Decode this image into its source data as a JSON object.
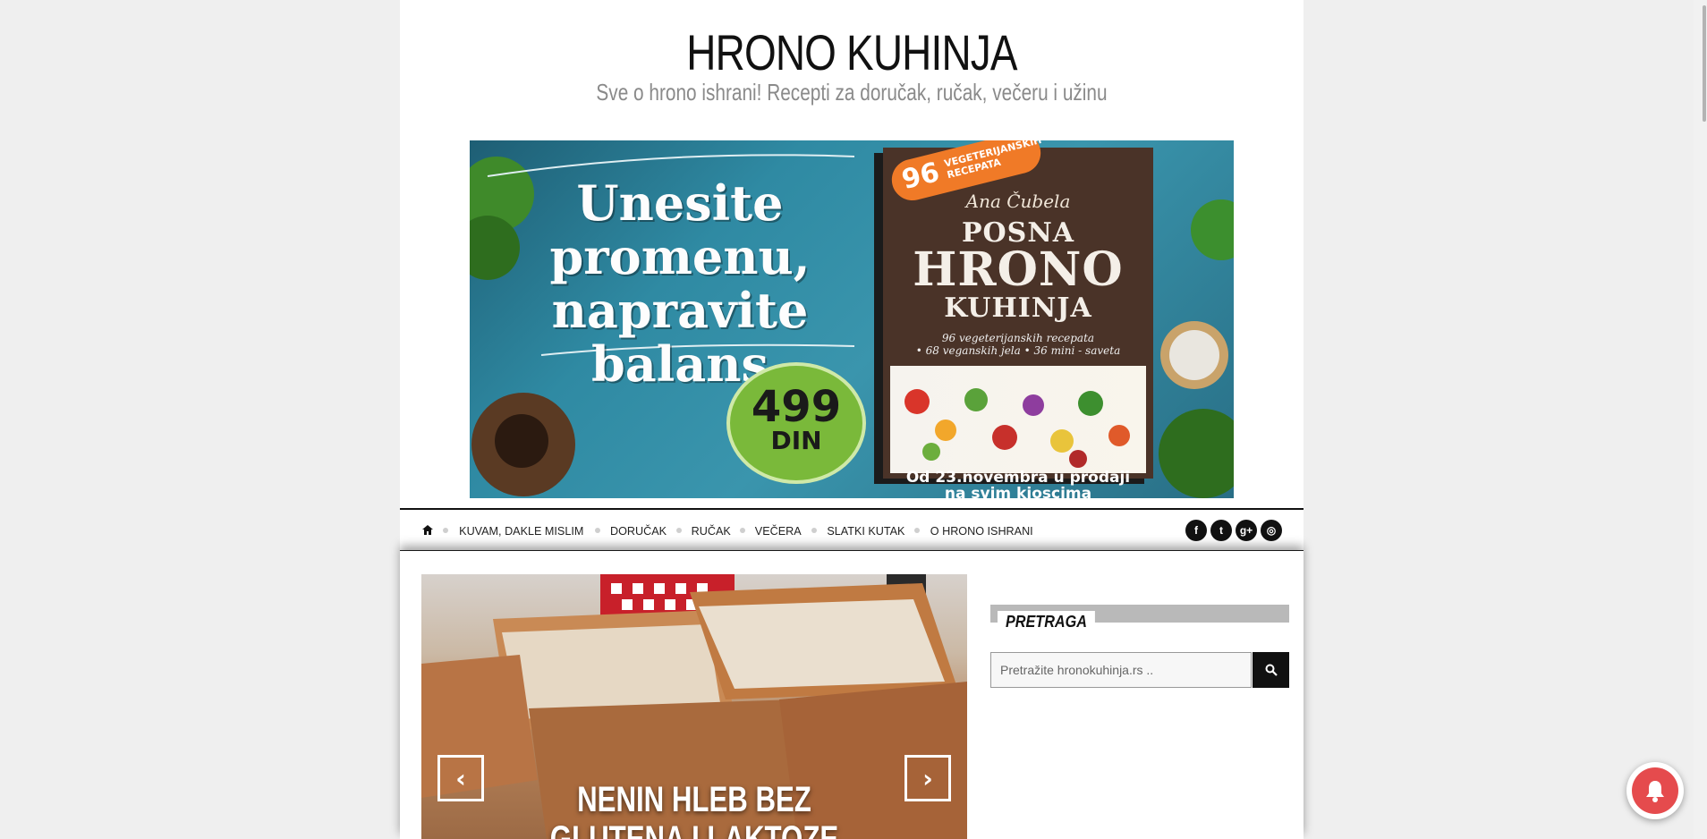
{
  "header": {
    "site_title": "HRONO KUHINJA",
    "tagline": "Sve o hrono ishrani! Recepti za doručak, ručak, večeru i užinu"
  },
  "banner": {
    "headline": [
      "Unesite",
      "promenu,",
      "napravite",
      "balans"
    ],
    "price": "499",
    "currency": "DIN",
    "badge_number": "96",
    "badge_text": "VEGETERIJANSKIH RECEPATA",
    "book_author": "Ana Čubela",
    "book_title_line1": "POSNA",
    "book_title_line2": "HRONO",
    "book_title_line3": "KUHINJA",
    "book_subtitle_line1": "96 vegeterijanskih recepata",
    "book_subtitle_line2": "• 68 veganskih jela • 36 mini - saveta",
    "footer_line1": "Od 23.novembra u prodaji",
    "footer_line2": "na svim kioscima"
  },
  "nav": {
    "home_icon": "home-icon",
    "items": [
      "KUVAM, DAKLE MISLIM",
      "DORUČAK",
      "RUČAK",
      "VEČERA",
      "SLATKI KUTAK",
      "O HRONO ISHRANI"
    ],
    "social": [
      {
        "icon": "facebook-icon",
        "glyph": "f"
      },
      {
        "icon": "twitter-icon",
        "glyph": "t"
      },
      {
        "icon": "google-plus-icon",
        "glyph": "g+"
      },
      {
        "icon": "instagram-icon",
        "glyph": "◎"
      }
    ]
  },
  "slider": {
    "title": "NENIN HLEB BEZ GLUTENA I LAKTOZE",
    "prev_glyph": "‹",
    "next_glyph": "›"
  },
  "sidebar": {
    "search_widget_title": "PRETRAGA",
    "search_placeholder": "Pretražite hronokuhinja.rs .."
  },
  "colors": {
    "page_bg": "#efefef",
    "accent": "#111111",
    "price_green": "#7ab93a",
    "badge_orange": "#f07a27",
    "notify_red": "#e54b4d"
  }
}
